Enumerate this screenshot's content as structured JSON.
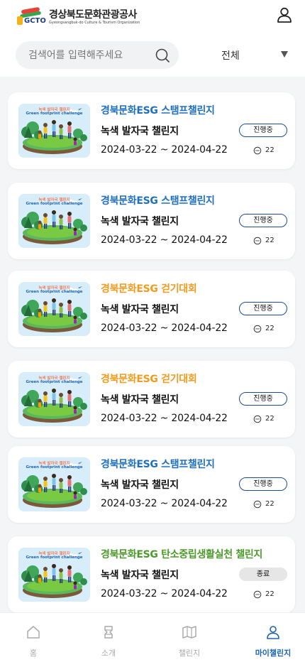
{
  "header": {
    "logo_mark": "GCTO",
    "logo_name": "경상북도문화관광공사",
    "logo_en": "Gyeongsangbuk-do Culture & Tourism Organization"
  },
  "search": {
    "placeholder": "검색어를 입력해주세요",
    "value": ""
  },
  "filter": {
    "selected": "전체"
  },
  "thumbnail": {
    "line1": "녹색 발자국 챌린지",
    "line2": "Green footprint challenge"
  },
  "cards": [
    {
      "title": "경북문화ESG 스탬프챌린지",
      "title_color": "#1f6fc1",
      "subtitle": "녹색 발자국 챌린지",
      "date": "2024-03-22 ~ 2024-04-22",
      "status": "진행중",
      "status_active": true,
      "comments": "22"
    },
    {
      "title": "경북문화ESG 스탬프챌린지",
      "title_color": "#1f6fc1",
      "subtitle": "녹색 발자국 챌린지",
      "date": "2024-03-22 ~ 2024-04-22",
      "status": "진행중",
      "status_active": true,
      "comments": "22"
    },
    {
      "title": "경북문화ESG 걷기대회",
      "title_color": "#f29a1c",
      "subtitle": "녹색 발자국 챌린지",
      "date": "2024-03-22 ~ 2024-04-22",
      "status": "진행중",
      "status_active": true,
      "comments": "22"
    },
    {
      "title": "경북문화ESG 걷기대회",
      "title_color": "#f29a1c",
      "subtitle": "녹색 발자국 챌린지",
      "date": "2024-03-22 ~ 2024-04-22",
      "status": "진행중",
      "status_active": true,
      "comments": "22"
    },
    {
      "title": "경북문화ESG 스탬프챌린지",
      "title_color": "#1f6fc1",
      "subtitle": "녹색 발자국 챌린지",
      "date": "2024-03-22 ~ 2024-04-22",
      "status": "진행중",
      "status_active": true,
      "comments": "22"
    },
    {
      "title": "경북문화ESG 탄소중립생활실천 챌린지",
      "title_color": "#4c9a2a",
      "subtitle": "녹색 발자국 챌린지",
      "date": "2024-03-22 ~ 2024-04-22",
      "status": "종료",
      "status_active": false,
      "comments": "22"
    }
  ],
  "tabs": [
    {
      "label": "홈",
      "icon": "home-icon",
      "active": false
    },
    {
      "label": "소개",
      "icon": "intro-icon",
      "active": false
    },
    {
      "label": "챌린지",
      "icon": "map-icon",
      "active": false
    },
    {
      "label": "마이챌린지",
      "icon": "user-icon",
      "active": true
    }
  ],
  "colors": {
    "active_tab": "#1a63b8",
    "inactive_tab": "#aaaaaa",
    "badge_border": "#1a4d8f"
  }
}
